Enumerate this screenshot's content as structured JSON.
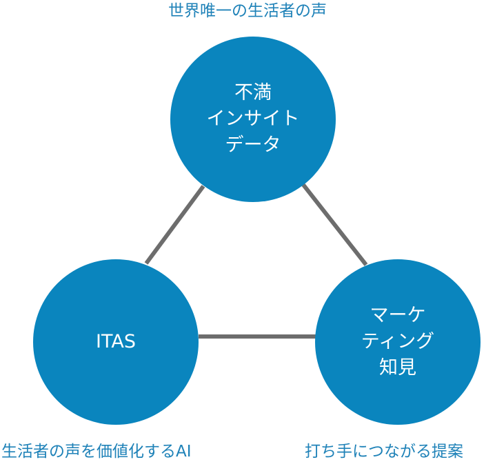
{
  "captions": {
    "top": "世界唯一の生活者の声",
    "bottom_left": "生活者の声を価値化するAI",
    "bottom_right": "打ち手につながる提案"
  },
  "nodes": {
    "top": {
      "lines": [
        "不満",
        "インサイト",
        "データ"
      ]
    },
    "left": {
      "lines": [
        "ITAS"
      ]
    },
    "right": {
      "lines": [
        "マーケ",
        "ティング",
        "知見"
      ]
    }
  },
  "colors": {
    "node_fill": "#0a85be",
    "connector": "#6d6d6d",
    "caption": "#1f82b8",
    "node_text": "#ffffff"
  }
}
